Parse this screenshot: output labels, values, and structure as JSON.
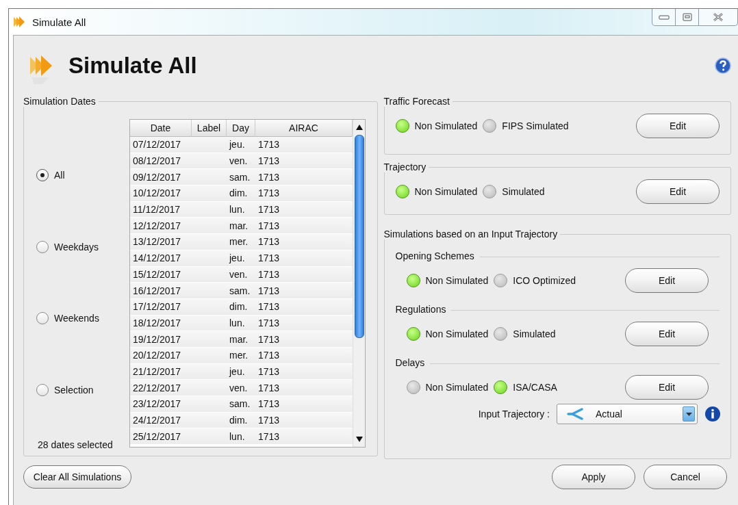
{
  "window": {
    "title": "Simulate All"
  },
  "header": {
    "title": "Simulate All"
  },
  "dates": {
    "title": "Simulation Dates",
    "options": [
      {
        "label": "All",
        "selected": true
      },
      {
        "label": "Weekdays",
        "selected": false
      },
      {
        "label": "Weekends",
        "selected": false
      },
      {
        "label": "Selection",
        "selected": false
      }
    ],
    "count": "28 dates selected",
    "table": {
      "columns": [
        "Date",
        "Label",
        "Day",
        "AIRAC"
      ],
      "rows": [
        {
          "date": "07/12/2017",
          "day": "jeu.",
          "airac": "1713"
        },
        {
          "date": "08/12/2017",
          "day": "ven.",
          "airac": "1713"
        },
        {
          "date": "09/12/2017",
          "day": "sam.",
          "airac": "1713"
        },
        {
          "date": "10/12/2017",
          "day": "dim.",
          "airac": "1713"
        },
        {
          "date": "11/12/2017",
          "day": "lun.",
          "airac": "1713"
        },
        {
          "date": "12/12/2017",
          "day": "mar.",
          "airac": "1713"
        },
        {
          "date": "13/12/2017",
          "day": "mer.",
          "airac": "1713"
        },
        {
          "date": "14/12/2017",
          "day": "jeu.",
          "airac": "1713"
        },
        {
          "date": "15/12/2017",
          "day": "ven.",
          "airac": "1713"
        },
        {
          "date": "16/12/2017",
          "day": "sam.",
          "airac": "1713"
        },
        {
          "date": "17/12/2017",
          "day": "dim.",
          "airac": "1713"
        },
        {
          "date": "18/12/2017",
          "day": "lun.",
          "airac": "1713"
        },
        {
          "date": "19/12/2017",
          "day": "mar.",
          "airac": "1713"
        },
        {
          "date": "20/12/2017",
          "day": "mer.",
          "airac": "1713"
        },
        {
          "date": "21/12/2017",
          "day": "jeu.",
          "airac": "1713"
        },
        {
          "date": "22/12/2017",
          "day": "ven.",
          "airac": "1713"
        },
        {
          "date": "23/12/2017",
          "day": "sam.",
          "airac": "1713"
        },
        {
          "date": "24/12/2017",
          "day": "dim.",
          "airac": "1713"
        },
        {
          "date": "25/12/2017",
          "day": "lun.",
          "airac": "1713"
        }
      ]
    }
  },
  "groups": [
    {
      "title": "Traffic Forecast",
      "states": [
        {
          "label": "Non Simulated",
          "on": true
        },
        {
          "label": "FIPS Simulated",
          "on": false
        }
      ],
      "button": "Edit"
    },
    {
      "title": "Trajectory",
      "states": [
        {
          "label": "Non Simulated",
          "on": true
        },
        {
          "label": "Simulated",
          "on": false
        }
      ],
      "button": "Edit"
    }
  ],
  "input_simulations": {
    "title": "Simulations based on an Input Trajectory",
    "sections": [
      {
        "title": "Opening Schemes",
        "states": [
          {
            "label": "Non Simulated",
            "on": true
          },
          {
            "label": "ICO Optimized",
            "on": false
          }
        ],
        "button": "Edit"
      },
      {
        "title": "Regulations",
        "states": [
          {
            "label": "Non Simulated",
            "on": true
          },
          {
            "label": "Simulated",
            "on": false
          }
        ],
        "button": "Edit"
      },
      {
        "title": "Delays",
        "states": [
          {
            "label": "Non Simulated",
            "on": false
          },
          {
            "label": "ISA/CASA",
            "on": true
          }
        ],
        "button": "Edit"
      }
    ],
    "input_trajectory": {
      "label": "Input Trajectory :",
      "value": "Actual"
    }
  },
  "buttons": {
    "clear": "Clear All Simulations",
    "apply": "Apply",
    "cancel": "Cancel"
  }
}
